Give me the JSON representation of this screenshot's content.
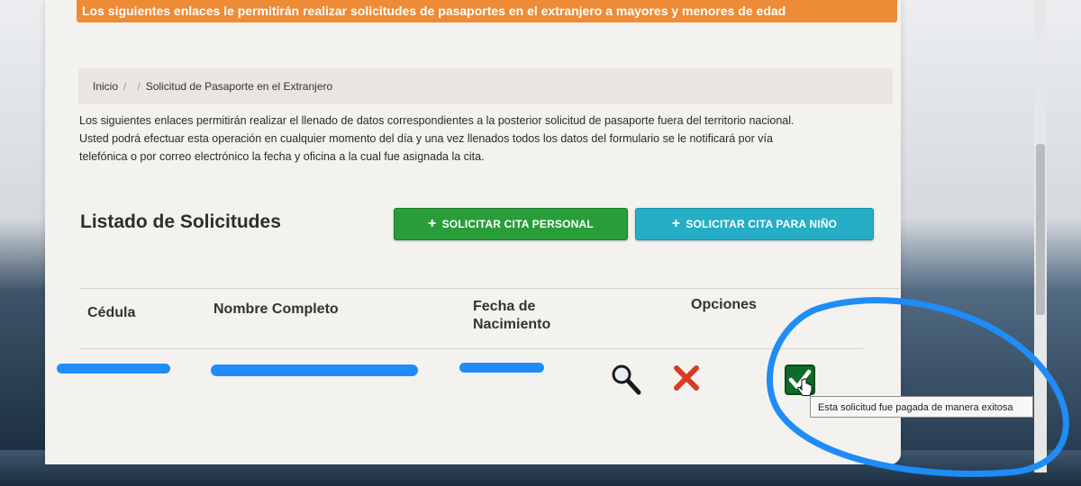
{
  "banner": {
    "text": "Los siguientes enlaces le permitirán realizar solicitudes de pasaportes en el extranjero a mayores y menores de edad"
  },
  "breadcrumb": {
    "home": "Inicio",
    "separator": "/",
    "current": "Solicitud de Pasaporte en el Extranjero"
  },
  "intro": {
    "line1": "Los siguientes enlaces permitirán realizar el llenado de datos correspondientes a la posterior solicitud de pasaporte fuera del territorio nacional.",
    "line2": "Usted podrá efectuar esta operación en cualquier momento del día y una vez llenados todos los datos del formulario se le notificará por vía",
    "line3": "telefónica o por correo electrónico la fecha y oficina a la cual fue asignada la cita."
  },
  "list": {
    "title": "Listado de Solicitudes",
    "btn_personal": "SOLICITAR CITA PERSONAL",
    "btn_nino": "SOLICITAR CITA PARA NIÑO",
    "plus": "+"
  },
  "table": {
    "headers": {
      "cedula": "Cédula",
      "nombre": "Nombre Completo",
      "fecha_l1": "Fecha de",
      "fecha_l2": "Nacimiento",
      "opciones": "Opciones"
    }
  },
  "row": {
    "tooltip": "Esta solicitud fue pagada de manera exitosa"
  },
  "icons": {
    "view": "magnifier-icon",
    "delete": "red-x-icon",
    "paid": "green-check-icon",
    "cursor": "hand-cursor-icon"
  },
  "colors": {
    "banner": "#ee8b36",
    "btn_personal": "#2a9d3b",
    "btn_nino": "#25aec6",
    "redaction": "#1f8cf7",
    "annotation": "#1f8cf7"
  }
}
